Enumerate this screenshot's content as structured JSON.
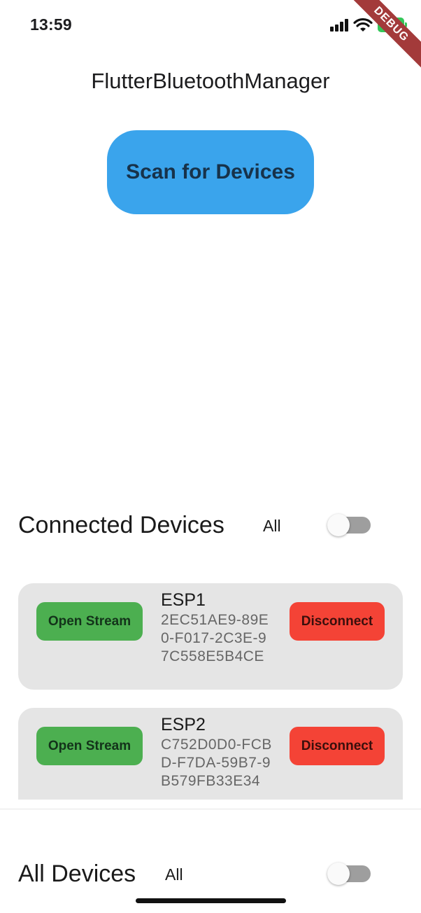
{
  "status_bar": {
    "time": "13:59",
    "battery": "100"
  },
  "debug_banner": "DEBUG",
  "app": {
    "title": "FlutterBluetoothManager"
  },
  "scan_button": {
    "label": "Scan for Devices"
  },
  "connected_section": {
    "title": "Connected Devices",
    "filter": "All",
    "toggle_on": false,
    "devices": [
      {
        "name": "ESP1",
        "id": "2EC51AE9-89E0-F017-2C3E-97C558E5B4CE",
        "open_label": "Open Stream",
        "disconnect_label": "Disconnect"
      },
      {
        "name": "ESP2",
        "id": "C752D0D0-FCBD-F7DA-59B7-9B579FB33E34",
        "open_label": "Open Stream",
        "disconnect_label": "Disconnect"
      }
    ]
  },
  "all_section": {
    "title": "All Devices",
    "filter": "All",
    "toggle_on": false
  },
  "colors": {
    "scan_button": "#3aa4ec",
    "open_stream": "#4caf50",
    "disconnect": "#f44336",
    "card_bg": "#e5e5e5"
  }
}
